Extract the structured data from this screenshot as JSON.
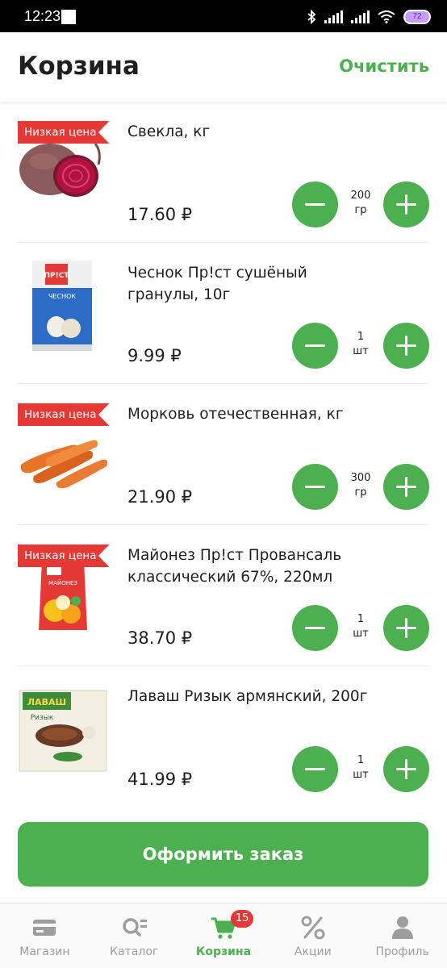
{
  "status_bar": {
    "time": "12:23",
    "battery": "72"
  },
  "header": {
    "title": "Корзина",
    "clear_label": "Очистить"
  },
  "cart": {
    "items": [
      {
        "badge": "Низкая цена",
        "name": "Свекла, кг",
        "price": "17.60 ₽",
        "qty": "200",
        "unit": "гр",
        "image": "beet"
      },
      {
        "badge": "",
        "name": "Чеснок Пр!ст сушёный гранулы, 10г",
        "price": "9.99 ₽",
        "qty": "1",
        "unit": "шт",
        "image": "garlic-pack"
      },
      {
        "badge": "Низкая цена",
        "name": "Морковь отечественная, кг",
        "price": "21.90 ₽",
        "qty": "300",
        "unit": "гр",
        "image": "carrots"
      },
      {
        "badge": "Низкая цена",
        "name": "Майонез Пр!ст Провансаль классический 67%, 220мл",
        "price": "38.70 ₽",
        "qty": "1",
        "unit": "шт",
        "image": "mayonnaise-pack"
      },
      {
        "badge": "",
        "name": "Лаваш Ризык армянский, 200г",
        "price": "41.99 ₽",
        "qty": "1",
        "unit": "шт",
        "image": "lavash-pack"
      }
    ],
    "pack_texts": {
      "garlic_brand": "ПР!СТ",
      "garlic_label": "ЧЕСНОК",
      "mayo_brand": "МАЙОНЕЗ",
      "lavash_title": "ЛАВАШ",
      "lavash_brand": "Ризык"
    }
  },
  "checkout": {
    "label": "Оформить заказ"
  },
  "nav": {
    "items": [
      {
        "label": "Магазин",
        "icon": "card-icon"
      },
      {
        "label": "Каталог",
        "icon": "catalog-search-icon"
      },
      {
        "label": "Корзина",
        "icon": "cart-icon",
        "badge": "15",
        "active": true
      },
      {
        "label": "Акции",
        "icon": "percent-icon"
      },
      {
        "label": "Профиль",
        "icon": "profile-icon"
      }
    ]
  },
  "colors": {
    "accent": "#4caf50",
    "badge_red": "#e53935",
    "inactive": "#9e9e9e"
  }
}
